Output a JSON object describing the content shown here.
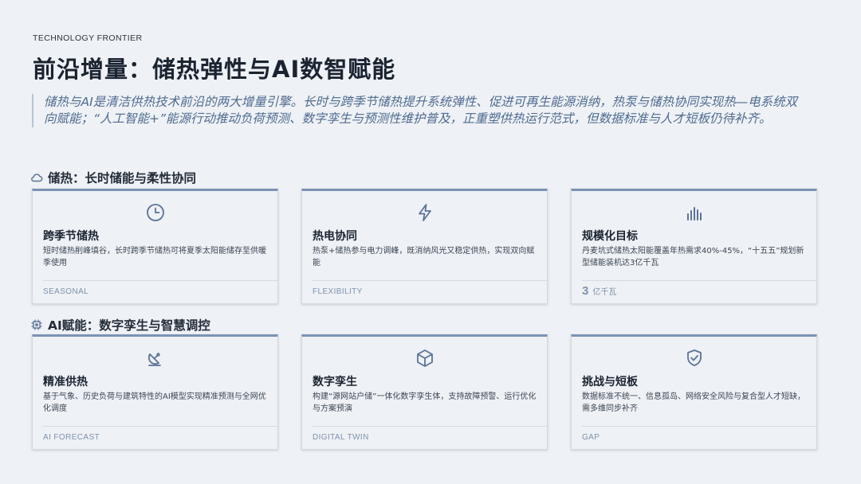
{
  "header": {
    "eyebrow": "TECHNOLOGY FRONTIER",
    "title": "前沿增量：储热弹性与AI数智赋能",
    "intro": "储热与AI是清洁供热技术前沿的两大增量引擎。长时与跨季节储热提升系统弹性、促进可再生能源消纳，热泵与储热协同实现热—电系统双向赋能；“人工智能+”能源行动推动负荷预测、数字孪生与预测性维护普及，正重塑供热运行范式，但数据标准与人才短板仍待补齐。"
  },
  "sections": [
    {
      "title": "储热：长时储能与柔性协同",
      "icon": "cloud-icon",
      "cards": [
        {
          "icon": "clock-icon",
          "title": "跨季节储热",
          "desc": "短时储热削峰填谷，长时跨季节储热可将夏季太阳能储存至供暖季使用",
          "tag": "SEASONAL"
        },
        {
          "icon": "lightning-icon",
          "title": "热电协同",
          "desc": "热泵+储热参与电力调峰，既消纳风光又稳定供热，实现双向赋能",
          "tag": "FLEXIBILITY"
        },
        {
          "icon": "bar-chart-icon",
          "title": "规模化目标",
          "desc": "丹麦坑式储热太阳能覆盖年热需求40%-45%，“十五五”规划新型储能装机达3亿千瓦",
          "metric_value": "3",
          "metric_unit": "亿千瓦"
        }
      ]
    },
    {
      "title": "AI赋能：数字孪生与智慧调控",
      "icon": "chip-icon",
      "cards": [
        {
          "icon": "satellite-dish-icon",
          "title": "精准供热",
          "desc": "基于气象、历史负荷与建筑特性的AI模型实现精准预测与全网优化调度",
          "tag": "AI FORECAST"
        },
        {
          "icon": "cube-icon",
          "title": "数字孪生",
          "desc": "构建“源网站户储”一体化数字孪生体，支持故障预警、运行优化与方案预演",
          "tag": "DIGITAL TWIN"
        },
        {
          "icon": "shield-check-icon",
          "title": "挑战与短板",
          "desc": "数据标准不统一、信息孤岛、网络安全风险与复合型人才短缺，需多维同步补齐",
          "tag": "GAP"
        }
      ]
    }
  ]
}
